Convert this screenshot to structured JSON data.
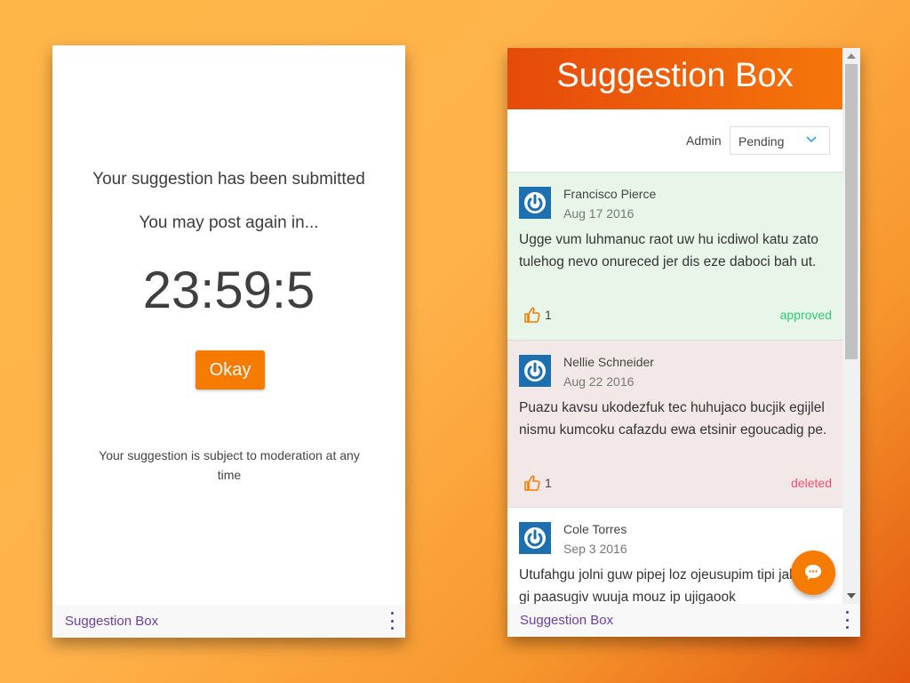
{
  "left": {
    "message_submitted": "Your suggestion has been submitted",
    "message_wait": "You may post again in...",
    "timer": "23:59:5",
    "okay_label": "Okay",
    "note": "Your suggestion is subject to moderation at any time",
    "footer_label": "Suggestion Box"
  },
  "right": {
    "title": "Suggestion Box",
    "admin_label": "Admin",
    "filter_selected": "Pending",
    "suggestions": [
      {
        "name": "Francisco Pierce",
        "date": "Aug 17 2016",
        "text": "Ugge vum luhmanuc raot uw hu icdiwol katu zato tulehog nevo onureced jer dis eze daboci bah ut.",
        "likes": "1",
        "status": "approved"
      },
      {
        "name": "Nellie Schneider",
        "date": "Aug 22 2016",
        "text": "Puazu kavsu ukodezfuk tec huhujaco bucjik egijlel nismu kumcoku cafazdu ewa etsinir egoucadig pe.",
        "likes": "1",
        "status": "deleted"
      },
      {
        "name": "Cole Torres",
        "date": "Sep 3 2016",
        "text": "Utufahgu jolni guw pipej loz ojeusupim tipi jakkoaz gi paasugiv wuuja mouz ip ujigaook",
        "likes": "",
        "status": ""
      }
    ],
    "footer_label": "Suggestion Box"
  },
  "colors": {
    "accent": "#f57c00",
    "approved": "#2ecc71",
    "deleted": "#f0506e",
    "footer_text": "#6a3fa0"
  },
  "icons": {
    "avatar": "power-icon",
    "like": "thumbs-up-icon",
    "fab": "chat-bubble-icon",
    "menu": "more-vert-icon",
    "dropdown": "chevron-down-icon"
  }
}
